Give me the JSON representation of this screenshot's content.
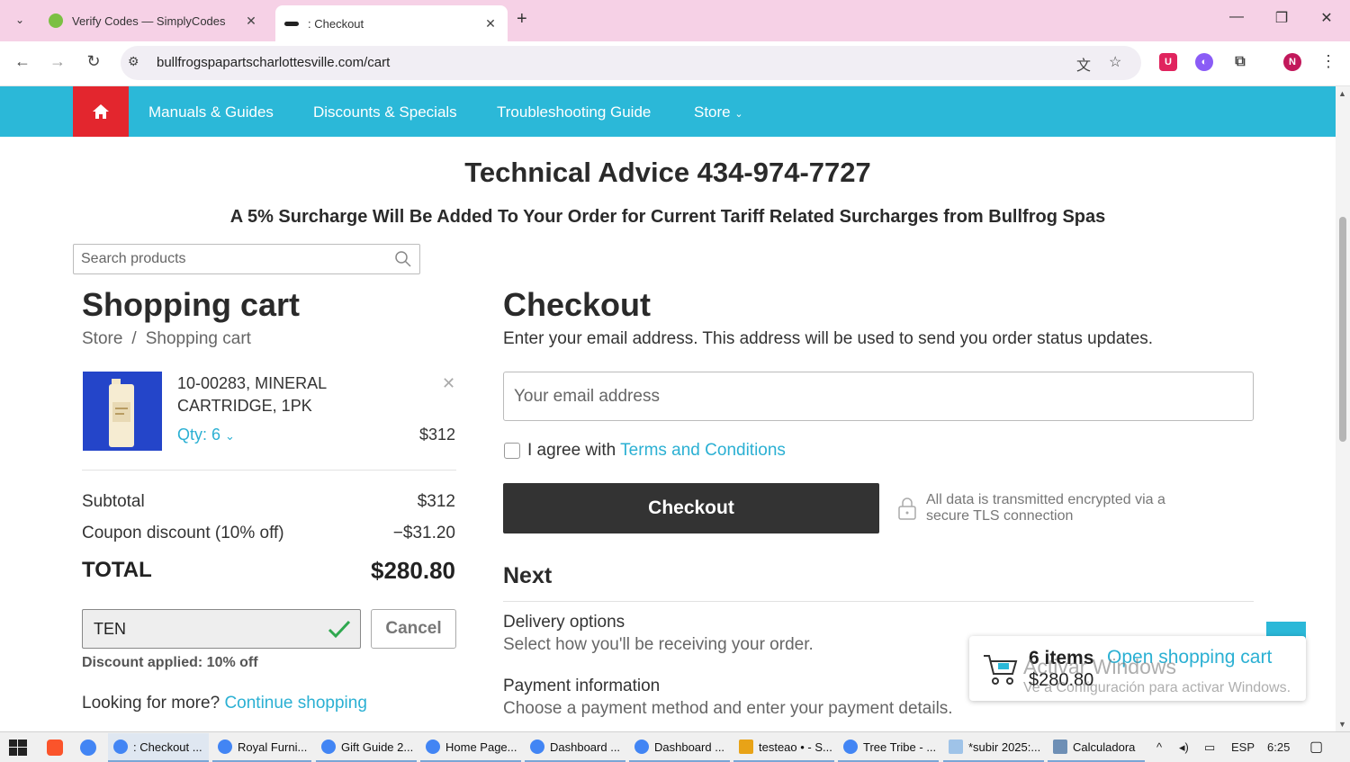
{
  "browser": {
    "tabs": [
      {
        "title": "Verify Codes — SimplyCodes",
        "active": false
      },
      {
        "title": ": Checkout",
        "active": true
      }
    ],
    "url": "bullfrogspapartscharlottesville.com/cart",
    "profile_initial": "N"
  },
  "site_nav": {
    "items": [
      "Manuals & Guides",
      "Discounts & Specials",
      "Troubleshooting Guide",
      "Store"
    ]
  },
  "header": {
    "tech_advice": "Technical Advice 434-974-7727",
    "surcharge": "A 5% Surcharge Will Be Added To Your Order for Current Tariff Related Surcharges from Bullfrog Spas"
  },
  "search": {
    "placeholder": "Search products"
  },
  "cart": {
    "title": "Shopping cart",
    "breadcrumb": {
      "store": "Store",
      "sep": "/",
      "current": "Shopping cart"
    },
    "item": {
      "name": "10-00283, MINERAL CARTRIDGE, 1PK",
      "qty": "Qty: 6",
      "price": "$312"
    },
    "subtotal_label": "Subtotal",
    "subtotal_value": "$312",
    "coupon_label": "Coupon discount (10% off)",
    "coupon_value": "−$31.20",
    "total_label": "TOTAL",
    "total_value": "$280.80",
    "coupon_code": "TEN",
    "cancel_label": "Cancel",
    "discount_applied": "Discount applied: 10% off",
    "more_prefix": "Looking for more?",
    "continue_link": "Continue shopping"
  },
  "checkout": {
    "title": "Checkout",
    "desc": "Enter your email address. This address will be used to send you order status updates.",
    "email_placeholder": "Your email address",
    "agree_prefix": "I agree with",
    "terms_link": "Terms and Conditions",
    "button": "Checkout",
    "secure_text": "All data is transmitted encrypted via a secure TLS connection",
    "next_title": "Next",
    "delivery_title": "Delivery options",
    "delivery_desc": "Select how you'll be receiving your order.",
    "payment_title": "Payment information",
    "payment_desc": "Choose a payment method and enter your payment details."
  },
  "minicart": {
    "count": "6 items",
    "open_link": "Open shopping cart",
    "total": "$280.80"
  },
  "watermark": {
    "line1": "Activar Windows",
    "line2": "Ve a Configuración para activar Windows."
  },
  "taskbar": {
    "items": [
      ": Checkout ...",
      "Royal Furni...",
      "Gift Guide 2...",
      "Home Page...",
      "Dashboard ...",
      "Dashboard ...",
      "testeao • - S...",
      "Tree Tribe - ...",
      "*subir 2025:...",
      "Calculadora"
    ],
    "lang": "ESP",
    "time": "6:25"
  },
  "colors": {
    "accent": "#2bb8d8",
    "home": "#e3262e",
    "link": "#2bb0d3",
    "tabbar": "#f6d1e6"
  }
}
